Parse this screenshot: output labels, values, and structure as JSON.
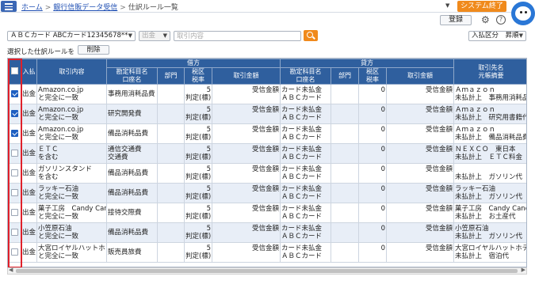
{
  "breadcrumb": {
    "home": "ホーム",
    "parent": "銀行信販データ受信",
    "current": "仕訳ルール一覧"
  },
  "header": {
    "exit_button": "システム終了",
    "login_button": "登録"
  },
  "filters": {
    "card_select": "ＡＢＣカード ABCカード12345678**",
    "io_select": "出金",
    "search_placeholder": "取引内容",
    "sort_select": "入払区分　昇順"
  },
  "selection": {
    "label": "選択した仕訳ルールを",
    "delete_button": "削除"
  },
  "table": {
    "headers": {
      "io": "入払",
      "content": "取引内容",
      "debit": "借方",
      "credit": "貸方",
      "account": [
        "勘定科目名",
        "口座名"
      ],
      "dept": "部門",
      "tax": [
        "税区",
        "税率"
      ],
      "amount": "取引金額",
      "partner": [
        "取引先名",
        "元帳摘要"
      ]
    },
    "rows": [
      {
        "checked": true,
        "io": "出金",
        "content": [
          "Amazon.co.jp",
          "と完全に一致"
        ],
        "debit_account": [
          "事務用消耗品費",
          ""
        ],
        "debit_dept": "",
        "debit_tax": [
          "5",
          "判定(標)"
        ],
        "debit_amount": "受信金額",
        "credit_account": [
          "カード未払金",
          "ＡＢＣカード"
        ],
        "credit_dept": "",
        "credit_tax": "0",
        "credit_amount": "受信金額",
        "partner": [
          "Ａｍａｚｏｎ",
          "未払計上　事務用消耗品費"
        ]
      },
      {
        "checked": true,
        "io": "出金",
        "content": [
          "Amazon.co.jp",
          "と完全に一致"
        ],
        "debit_account": [
          "研究開発費",
          ""
        ],
        "debit_dept": "",
        "debit_tax": [
          "5",
          "判定(標)"
        ],
        "debit_amount": "受信金額",
        "credit_account": [
          "カード未払金",
          "ＡＢＣカード"
        ],
        "credit_dept": "",
        "credit_tax": "0",
        "credit_amount": "受信金額",
        "partner": [
          "Ａｍａｚｏｎ",
          "未払計上　研究用書籍代"
        ]
      },
      {
        "checked": true,
        "io": "出金",
        "content": [
          "Amazon.co.jp",
          "と完全に一致"
        ],
        "debit_account": [
          "備品消耗品費",
          ""
        ],
        "debit_dept": "",
        "debit_tax": [
          "5",
          "判定(標)"
        ],
        "debit_amount": "受信金額",
        "credit_account": [
          "カード未払金",
          "ＡＢＣカード"
        ],
        "credit_dept": "",
        "credit_tax": "0",
        "credit_amount": "受信金額",
        "partner": [
          "Ａｍａｚｏｎ",
          "未払計上　備品消耗品費"
        ]
      },
      {
        "checked": false,
        "io": "出金",
        "content": [
          "ＥＴＣ",
          "を含む"
        ],
        "debit_account": [
          "通信交通費",
          "交通費"
        ],
        "debit_dept": "",
        "debit_tax": [
          "5",
          "判定(標)"
        ],
        "debit_amount": "受信金額",
        "credit_account": [
          "カード未払金",
          "ＡＢＣカード"
        ],
        "credit_dept": "",
        "credit_tax": "0",
        "credit_amount": "受信金額",
        "partner": [
          "ＮＥＸＣＯ　東日本",
          "未払計上　ＥＴＣ料金"
        ]
      },
      {
        "checked": false,
        "io": "出金",
        "content": [
          "ガソリンスタンド",
          "を含む"
        ],
        "debit_account": [
          "備品消耗品費",
          ""
        ],
        "debit_dept": "",
        "debit_tax": [
          "5",
          "判定(標)"
        ],
        "debit_amount": "受信金額",
        "credit_account": [
          "カード未払金",
          "ＡＢＣカード"
        ],
        "credit_dept": "",
        "credit_tax": "0",
        "credit_amount": "受信金額",
        "partner": [
          "",
          "未払計上　ガソリン代"
        ]
      },
      {
        "checked": false,
        "io": "出金",
        "content": [
          "ラッキー石油",
          "と完全に一致"
        ],
        "debit_account": [
          "備品消耗品費",
          ""
        ],
        "debit_dept": "",
        "debit_tax": [
          "5",
          "判定(標)"
        ],
        "debit_amount": "受信金額",
        "credit_account": [
          "カード未払金",
          "ＡＢＣカード"
        ],
        "credit_dept": "",
        "credit_tax": "0",
        "credit_amount": "受信金額",
        "partner": [
          "ラッキー石油",
          "未払計上　ガソリン代"
        ]
      },
      {
        "checked": false,
        "io": "出金",
        "content": [
          "菓子工房　Candy Car",
          "と完全に一致"
        ],
        "debit_account": [
          "接待交際費",
          ""
        ],
        "debit_dept": "",
        "debit_tax": [
          "5",
          "判定(標)"
        ],
        "debit_amount": "受信金額",
        "credit_account": [
          "カード未払金",
          "ＡＢＣカード"
        ],
        "credit_dept": "",
        "credit_tax": "0",
        "credit_amount": "受信金額",
        "partner": [
          "菓子工房　Candy Candy",
          "未払計上　お土産代"
        ]
      },
      {
        "checked": false,
        "io": "出金",
        "content": [
          "小笠原石油",
          "と完全に一致"
        ],
        "debit_account": [
          "備品消耗品費",
          ""
        ],
        "debit_dept": "",
        "debit_tax": [
          "5",
          "判定(標)"
        ],
        "debit_amount": "受信金額",
        "credit_account": [
          "カード未払金",
          "ＡＢＣカード"
        ],
        "credit_dept": "",
        "credit_tax": "0",
        "credit_amount": "受信金額",
        "partner": [
          "小笠原石油",
          "未払計上　ガソリン代"
        ]
      },
      {
        "checked": false,
        "io": "出金",
        "content": [
          "大宮ロイヤルハットホ",
          "と完全に一致"
        ],
        "debit_account": [
          "販売員旅費",
          ""
        ],
        "debit_dept": "",
        "debit_tax": [
          "5",
          "判定(標)"
        ],
        "debit_amount": "受信金額",
        "credit_account": [
          "カード未払金",
          "ＡＢＣカード"
        ],
        "credit_dept": "",
        "credit_tax": "0",
        "credit_amount": "受信金額",
        "partner": [
          "大宮ロイヤルハットホテル",
          "未払計上　宿泊代"
        ]
      }
    ]
  },
  "colors": {
    "header_bg": "#2f5f9e",
    "accent": "#f08a1c",
    "alt_row": "#e8eef7",
    "highlight": "#e0202a"
  },
  "icons": {
    "menu": "hamburger-icon",
    "gear": "gear-icon",
    "help": "help-icon",
    "search": "search-icon",
    "logo": "mascot-logo"
  }
}
